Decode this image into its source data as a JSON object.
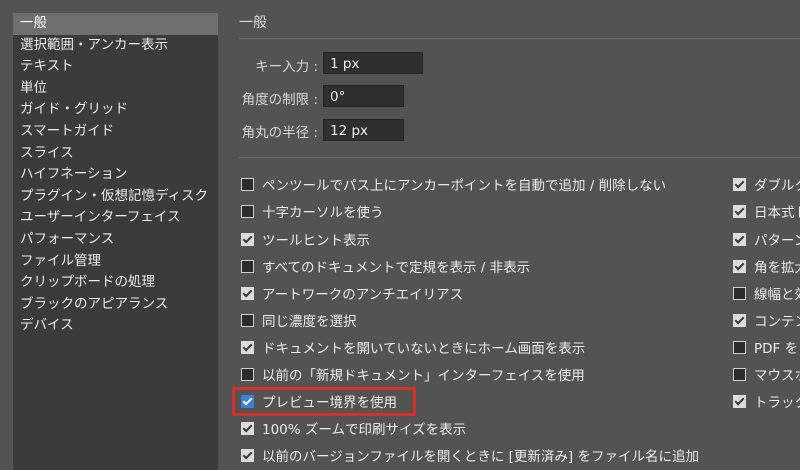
{
  "sidebar": {
    "items": [
      {
        "label": "一般",
        "selected": true
      },
      {
        "label": "選択範囲・アンカー表示"
      },
      {
        "label": "テキスト"
      },
      {
        "label": "単位"
      },
      {
        "label": "ガイド・グリッド"
      },
      {
        "label": "スマートガイド"
      },
      {
        "label": "スライス"
      },
      {
        "label": "ハイフネーション"
      },
      {
        "label": "プラグイン・仮想記憶ディスク"
      },
      {
        "label": "ユーザーインターフェイス"
      },
      {
        "label": "パフォーマンス"
      },
      {
        "label": "ファイル管理"
      },
      {
        "label": "クリップボードの処理"
      },
      {
        "label": "ブラックのアピアランス"
      },
      {
        "label": "デバイス"
      }
    ]
  },
  "panel": {
    "title": "一般",
    "fields": {
      "key_input": {
        "label": "キー入力 :",
        "value": "1 px"
      },
      "angle_constraint": {
        "label": "角度の制限 :",
        "value": "0°"
      },
      "corner_radius": {
        "label": "角丸の半径 :",
        "value": "12 px"
      }
    },
    "left_options": [
      {
        "label": "ペンツールでパス上にアンカーポイントを自動で追加 / 削除しない",
        "checked": false
      },
      {
        "label": "十字カーソルを使う",
        "checked": false
      },
      {
        "label": "ツールヒント表示",
        "checked": true
      },
      {
        "label": "すべてのドキュメントで定規を表示 / 非表示",
        "checked": false
      },
      {
        "label": "アートワークのアンチエイリアス",
        "checked": true
      },
      {
        "label": "同じ濃度を選択",
        "checked": false
      },
      {
        "label": "ドキュメントを開いていないときにホーム画面を表示",
        "checked": true
      },
      {
        "label": "以前の「新規ドキュメント」インターフェイスを使用",
        "checked": false
      },
      {
        "label": "プレビュー境界を使用",
        "checked": true,
        "highlighted": true
      },
      {
        "label": "100% ズームで印刷サイズを表示",
        "checked": true
      },
      {
        "label": "以前のバージョンファイルを開くときに [更新済み] をファイル名に追加",
        "checked": true
      }
    ],
    "right_options": [
      {
        "label": "ダブルク",
        "checked": true
      },
      {
        "label": "日本式ト",
        "checked": true
      },
      {
        "label": "パターン",
        "checked": true
      },
      {
        "label": "角を拡大",
        "checked": true
      },
      {
        "label": "線幅と効",
        "checked": false
      },
      {
        "label": "コンテン",
        "checked": true
      },
      {
        "label": "PDF を",
        "checked": false
      },
      {
        "label": "マウスホ",
        "checked": false
      },
      {
        "label": "トラック",
        "checked": true
      }
    ]
  },
  "colors": {
    "background": "#535353",
    "sidebar_bg": "#3b3b3b",
    "selected_item": "#6f6f6f",
    "highlight_border": "#d6302b",
    "checkbox_blue": "#3b80d8"
  }
}
